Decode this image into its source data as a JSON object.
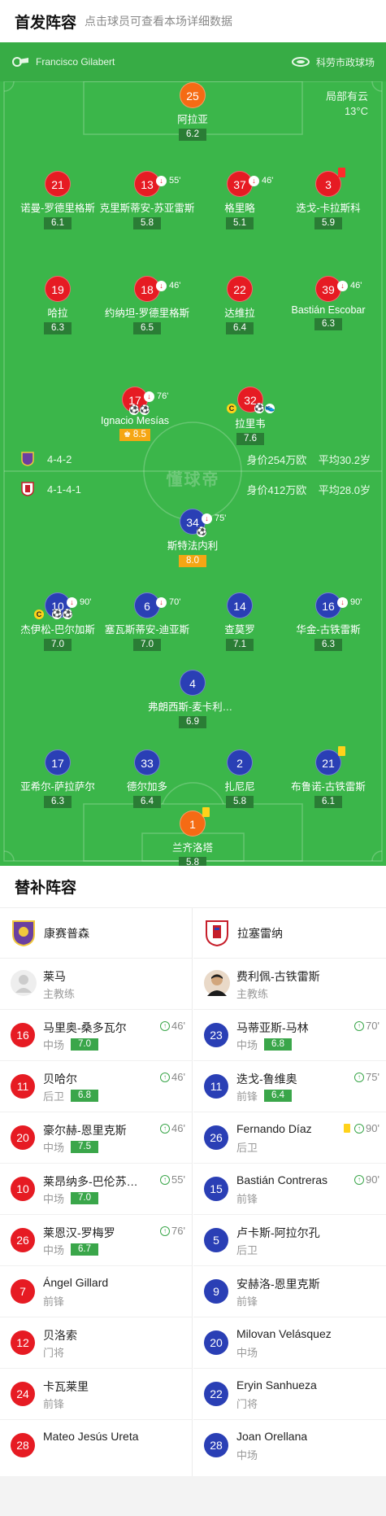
{
  "header": {
    "title": "首发阵容",
    "subtitle": "点击球员可查看本场详细数据"
  },
  "match_info": {
    "referee": "Francisco Gilabert",
    "venue": "科劳市政球场",
    "weather": "局部有云",
    "temperature": "13°C"
  },
  "watermark": "懂球帝",
  "home_team_line": {
    "formation": "4-4-2",
    "value": "身价254万欧",
    "age": "平均30.2岁"
  },
  "away_team_line": {
    "formation": "4-1-4-1",
    "value": "身价412万欧",
    "age": "平均28.0岁"
  },
  "home_players": [
    {
      "number": "25",
      "name": "阿拉亚",
      "rating": "6.2",
      "color": "orange"
    },
    {
      "number": "21",
      "name": "诺曼-罗德里格斯",
      "rating": "6.1",
      "color": "red"
    },
    {
      "number": "13",
      "name": "克里斯蒂安-苏亚雷斯",
      "rating": "5.8",
      "color": "red",
      "sub": "55'"
    },
    {
      "number": "37",
      "name": "格里略",
      "rating": "5.1",
      "color": "red",
      "sub": "46'"
    },
    {
      "number": "3",
      "name": "迭戈-卡拉斯科",
      "rating": "5.9",
      "color": "red",
      "card": "red"
    },
    {
      "number": "19",
      "name": "哈拉",
      "rating": "6.3",
      "color": "red"
    },
    {
      "number": "18",
      "name": "约纳坦-罗德里格斯",
      "rating": "6.5",
      "color": "red",
      "sub": "46'"
    },
    {
      "number": "22",
      "name": "达维拉",
      "rating": "6.4",
      "color": "red"
    },
    {
      "number": "39",
      "name": "Bastián Escobar",
      "rating": "6.3",
      "color": "red",
      "sub": "46'"
    },
    {
      "number": "17",
      "name": "Ignacio Mesías",
      "rating": "8.5",
      "color": "red",
      "sub": "76'",
      "mvp": true
    },
    {
      "number": "32",
      "name": "拉里韦",
      "rating": "7.6",
      "color": "red"
    }
  ],
  "away_players": [
    {
      "number": "34",
      "name": "斯特法内利",
      "rating": "8.0",
      "color": "blue",
      "sub": "75'"
    },
    {
      "number": "10",
      "name": "杰伊松-巴尔加斯",
      "rating": "7.0",
      "color": "blue",
      "sub": "90'"
    },
    {
      "number": "6",
      "name": "塞瓦斯蒂安-迪亚斯",
      "rating": "7.0",
      "color": "blue",
      "sub": "70'"
    },
    {
      "number": "14",
      "name": "查莫罗",
      "rating": "7.1",
      "color": "blue"
    },
    {
      "number": "16",
      "name": "华金-古铁雷斯",
      "rating": "6.3",
      "color": "blue",
      "sub": "90'"
    },
    {
      "number": "4",
      "name": "弗朗西斯-麦卡利斯特",
      "rating": "6.9",
      "color": "blue"
    },
    {
      "number": "17",
      "name": "亚希尔-萨拉萨尔",
      "rating": "6.3",
      "color": "blue"
    },
    {
      "number": "33",
      "name": "德尔加多",
      "rating": "6.4",
      "color": "blue"
    },
    {
      "number": "2",
      "name": "扎尼尼",
      "rating": "5.8",
      "color": "blue"
    },
    {
      "number": "21",
      "name": "布鲁诺-古铁雷斯",
      "rating": "6.1",
      "color": "blue",
      "card": "yellow"
    },
    {
      "number": "1",
      "name": "兰齐洛塔",
      "rating": "5.8",
      "color": "orange",
      "card": "yellow"
    }
  ],
  "subs_title": "替补阵容",
  "home_subs": {
    "team": "康赛普森",
    "coach": {
      "name": "莱马",
      "role": "主教练"
    },
    "players": [
      {
        "number": "16",
        "name": "马里奥-桑多瓦尔",
        "pos": "中场",
        "rating": "7.0",
        "time": "46'"
      },
      {
        "number": "11",
        "name": "贝哈尔",
        "pos": "后卫",
        "rating": "6.8",
        "time": "46'"
      },
      {
        "number": "20",
        "name": "豪尔赫-恩里克斯",
        "pos": "中场",
        "rating": "7.5",
        "time": "46'"
      },
      {
        "number": "10",
        "name": "莱昂纳多-巴伦苏埃拉",
        "pos": "中场",
        "rating": "7.0",
        "time": "55'"
      },
      {
        "number": "26",
        "name": "莱恩汉-罗梅罗",
        "pos": "中场",
        "rating": "6.7",
        "time": "76'"
      },
      {
        "number": "7",
        "name": "Ángel Gillard",
        "pos": "前锋"
      },
      {
        "number": "12",
        "name": "贝洛索",
        "pos": "门将"
      },
      {
        "number": "24",
        "name": "卡瓦莱里",
        "pos": "前锋"
      },
      {
        "number": "28",
        "name": "Mateo Jesús Ureta",
        "pos": ""
      }
    ]
  },
  "away_subs": {
    "team": "拉塞雷纳",
    "coach": {
      "name": "费利佩-古铁雷斯",
      "role": "主教练"
    },
    "players": [
      {
        "number": "23",
        "name": "马蒂亚斯-马林",
        "pos": "中场",
        "rating": "6.8",
        "time": "70'"
      },
      {
        "number": "11",
        "name": "迭戈-鲁维奥",
        "pos": "前锋",
        "rating": "6.4",
        "time": "75'"
      },
      {
        "number": "26",
        "name": "Fernando Díaz",
        "pos": "后卫",
        "time": "90'",
        "card": "yellow"
      },
      {
        "number": "15",
        "name": "Bastián Contreras",
        "pos": "前锋",
        "time": "90'"
      },
      {
        "number": "5",
        "name": "卢卡斯-阿拉尔孔",
        "pos": "后卫"
      },
      {
        "number": "9",
        "name": "安赫洛-恩里克斯",
        "pos": "前锋"
      },
      {
        "number": "20",
        "name": "Milovan Velásquez",
        "pos": "中场"
      },
      {
        "number": "22",
        "name": "Eryin Sanhueza",
        "pos": "门将"
      },
      {
        "number": "28",
        "name": "Joan Orellana",
        "pos": "中场"
      }
    ]
  }
}
